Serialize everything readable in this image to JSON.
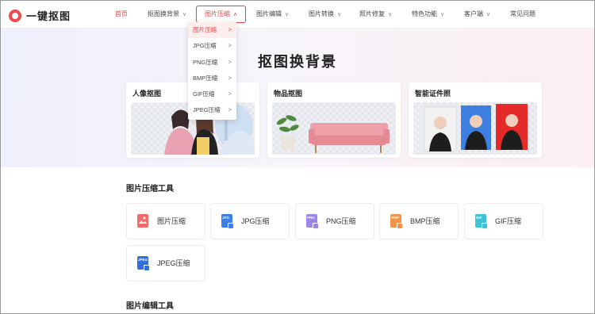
{
  "header": {
    "logo_text": "一键抠图",
    "nav": [
      {
        "label": "首页",
        "has_chevron": false
      },
      {
        "label": "抠图换背景",
        "has_chevron": true
      },
      {
        "label": "图片压缩",
        "has_chevron": true
      },
      {
        "label": "图片编辑",
        "has_chevron": true
      },
      {
        "label": "图片转换",
        "has_chevron": true
      },
      {
        "label": "照片修复",
        "has_chevron": true
      },
      {
        "label": "特色功能",
        "has_chevron": true
      },
      {
        "label": "客户端",
        "has_chevron": true
      },
      {
        "label": "常见问题",
        "has_chevron": false
      }
    ]
  },
  "dropdown": {
    "items": [
      {
        "label": "图片压缩",
        "selected": true
      },
      {
        "label": "JPG压缩"
      },
      {
        "label": "PNG压缩"
      },
      {
        "label": "BMP压缩"
      },
      {
        "label": "GIF压缩"
      },
      {
        "label": "JPEG压缩"
      }
    ]
  },
  "hero": {
    "title": "抠图换背景",
    "cards": [
      {
        "title": "人像抠图"
      },
      {
        "title": "物品抠图"
      },
      {
        "title": "智能证件照"
      }
    ]
  },
  "compress_section": {
    "title": "图片压缩工具",
    "tools": [
      {
        "label": "图片压缩",
        "icon": "image-compress-icon",
        "color": "#f26b6b",
        "tag": ""
      },
      {
        "label": "JPG压缩",
        "icon": "jpg-icon",
        "color": "#3c7fe8",
        "tag": "JPG"
      },
      {
        "label": "PNG压缩",
        "icon": "png-icon",
        "color": "#9a86e6",
        "tag": "PNG"
      },
      {
        "label": "BMP压缩",
        "icon": "bmp-icon",
        "color": "#f4924a",
        "tag": "BMP"
      },
      {
        "label": "GIF压缩",
        "icon": "gif-icon",
        "color": "#3cc4d6",
        "tag": "GIF"
      },
      {
        "label": "JPEG压缩",
        "icon": "jpeg-icon",
        "color": "#2f6fe0",
        "tag": "JPEG"
      }
    ]
  },
  "edit_section": {
    "title": "图片编辑工具"
  },
  "colors": {
    "accent": "#e74545",
    "idphoto_blue": "#3d7fe0",
    "idphoto_red": "#e52a2a"
  }
}
